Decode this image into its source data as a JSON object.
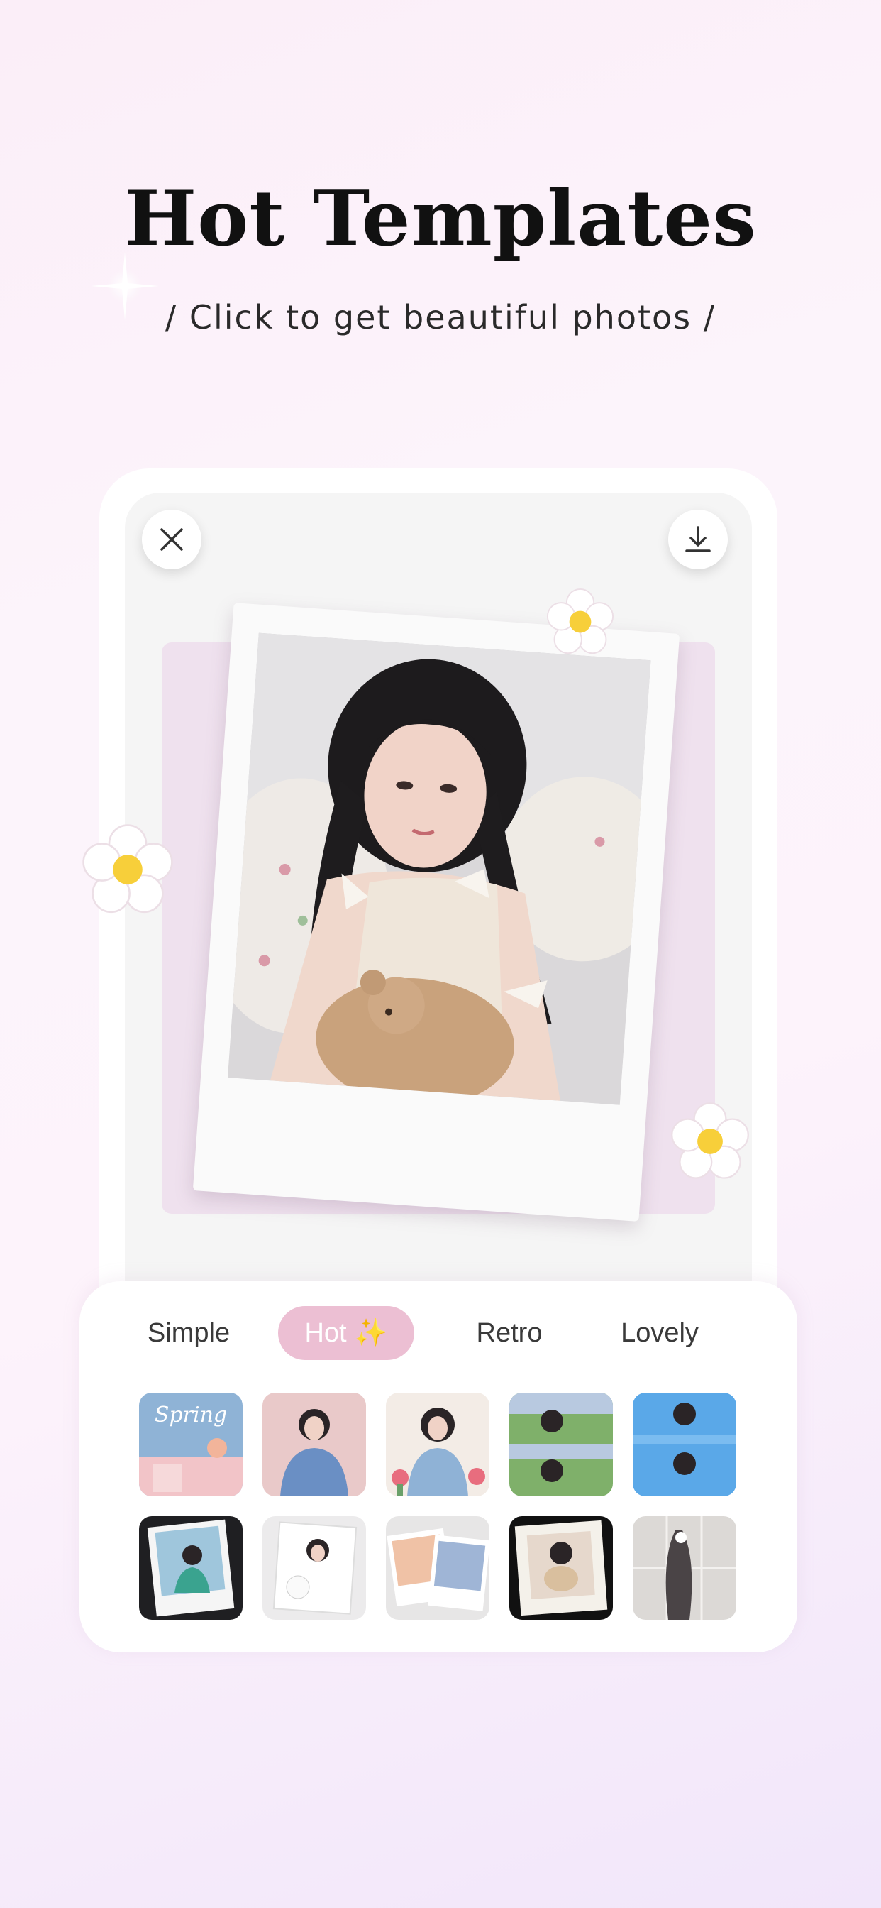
{
  "header": {
    "title": "Hot Templates",
    "subtitle": "/ Click to get beautiful photos /"
  },
  "preview": {
    "close_icon": "close-icon",
    "download_icon": "download-icon"
  },
  "tabs": [
    {
      "label": "Simple",
      "active": false
    },
    {
      "label": "Hot ✨",
      "active": true
    },
    {
      "label": "Retro",
      "active": false
    },
    {
      "label": "Lovely",
      "active": false
    }
  ],
  "templates": [
    {
      "name": "spring",
      "text": "Spring"
    },
    {
      "name": "blue-sweater"
    },
    {
      "name": "tulips"
    },
    {
      "name": "grass-duo"
    },
    {
      "name": "sky-duo"
    },
    {
      "name": "polaroid-teal"
    },
    {
      "name": "polaroid-puppy"
    },
    {
      "name": "sunset-couple"
    },
    {
      "name": "notebook-frame"
    },
    {
      "name": "grey-collage"
    }
  ],
  "colors": {
    "accent": "#ecbfd3",
    "title": "#111111",
    "flower_center": "#f7cf3a"
  }
}
